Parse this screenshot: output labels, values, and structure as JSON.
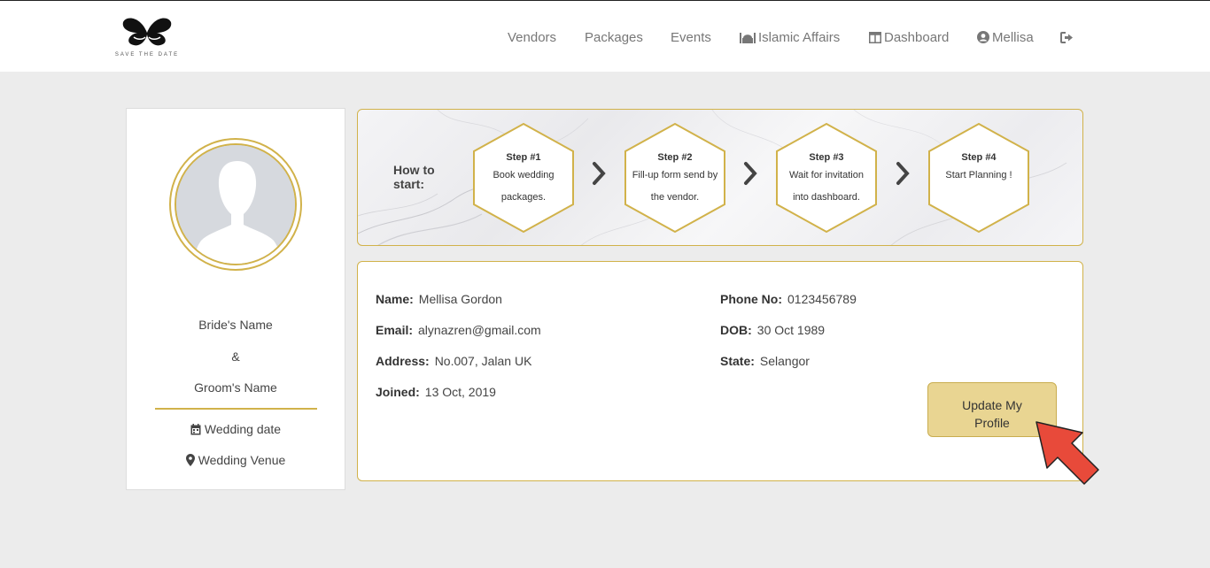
{
  "brand": {
    "logo_text": "SAVE THE DATE"
  },
  "nav": {
    "vendors": "Vendors",
    "packages": "Packages",
    "events": "Events",
    "islamic_affairs": "Islamic Affairs",
    "dashboard": "Dashboard",
    "user": "Mellisa"
  },
  "profile_card": {
    "bride": "Bride's Name",
    "amp": "&",
    "groom": "Groom's Name",
    "wedding_date": "Wedding date",
    "wedding_venue": "Wedding Venue"
  },
  "steps": {
    "heading_line1": "How to",
    "heading_line2": "start:",
    "items": [
      {
        "title": "Step #1",
        "line1": "Book wedding",
        "line2": "packages."
      },
      {
        "title": "Step #2",
        "line1": "Fill-up form send by",
        "line2": "the vendor."
      },
      {
        "title": "Step #3",
        "line1": "Wait for invitation",
        "line2": "into dashboard."
      },
      {
        "title": "Step #4",
        "line1": "Start Planning !",
        "line2": ""
      }
    ]
  },
  "profile": {
    "name_label": "Name:",
    "name": "Mellisa Gordon",
    "email_label": "Email:",
    "email": "alynazren@gmail.com",
    "address_label": "Address:",
    "address": "No.007, Jalan UK",
    "joined_label": "Joined:",
    "joined": "13 Oct, 2019",
    "phone_label": "Phone No:",
    "phone": "0123456789",
    "dob_label": "DOB:",
    "dob": "30 Oct 1989",
    "state_label": "State:",
    "state": "Selangor",
    "update_line1": "Update My",
    "update_line2": "Profile"
  },
  "colors": {
    "accent": "#d1b24a",
    "button": "#e9d592",
    "arrow": "#e84a3a"
  }
}
